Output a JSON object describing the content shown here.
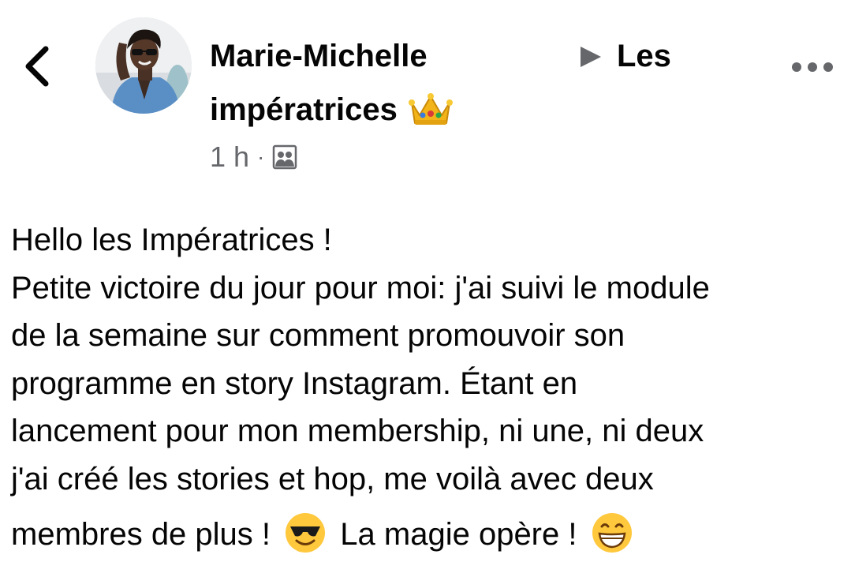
{
  "header": {
    "author_name": "Marie-Michelle",
    "group_name_part1": "Les",
    "group_name_part2": "impératrices",
    "group_emoji": "crown-icon",
    "timestamp": "1 h",
    "separator": "·",
    "visibility_icon": "group-icon"
  },
  "post": {
    "lines": [
      "Hello les Impératrices !",
      "Petite victoire du jour pour moi: j'ai suivi le module",
      "de la semaine sur comment promouvoir son",
      "programme en story Instagram. Étant en",
      "lancement pour mon membership, ni une, ni deux",
      "j'ai créé les stories et hop, me voilà avec deux"
    ],
    "last_line_part1": "membres de plus !",
    "last_line_part2": "La magie opère !",
    "emoji1": "sunglasses-face-icon",
    "emoji2": "grinning-face-icon"
  },
  "colors": {
    "text": "#050505",
    "secondary_text": "#65676b",
    "background": "#ffffff"
  }
}
